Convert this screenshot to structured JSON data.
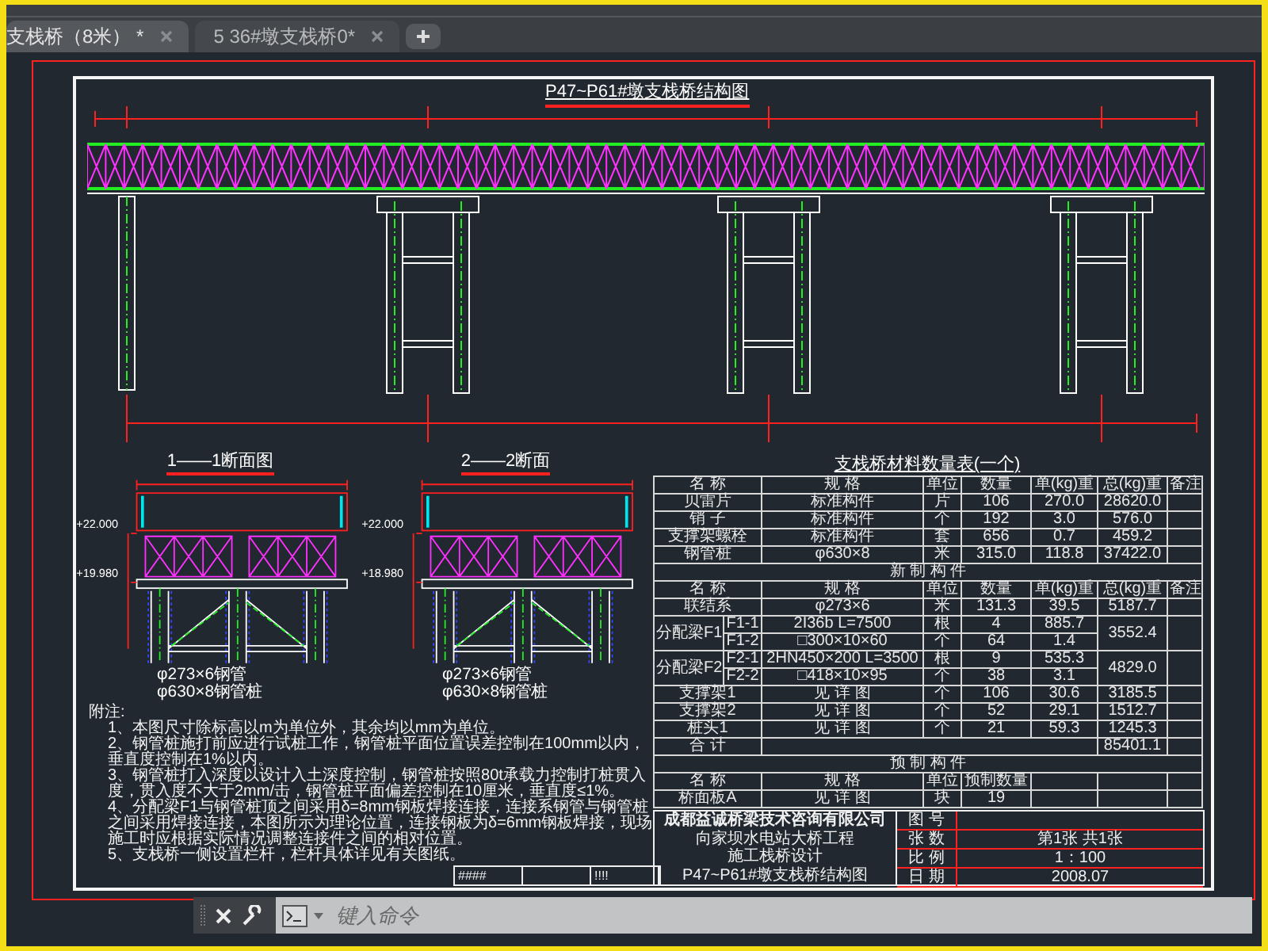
{
  "tabs": [
    {
      "label": "支栈桥（8米） *",
      "selected": true
    },
    {
      "label": "5 36#墩支栈桥0*",
      "selected": false
    }
  ],
  "drawing": {
    "title": "P47~P61#墩支栈桥结构图",
    "sections": [
      {
        "title": "1——1断面图",
        "deck_level": "+22.000",
        "cap_level": "+19.980",
        "brace_label": "φ273×6钢管",
        "pile_label": "φ630×8钢管桩"
      },
      {
        "title": "2——2断面",
        "deck_level": "+22.000",
        "cap_level": "+18.980",
        "brace_label": "φ273×6钢管",
        "pile_label": "φ630×8钢管桩"
      }
    ],
    "material_table": {
      "title": "支栈桥材料数量表(一个)",
      "rows": [
        {
          "kind": "header",
          "cells": [
            "名 称",
            "规 格",
            "单位",
            "数量",
            "单(kg)重",
            "总(kg)重",
            "备注"
          ]
        },
        {
          "kind": "item",
          "cells": [
            "贝雷片",
            "标准构件",
            "片",
            "106",
            "270.0",
            "28620.0"
          ]
        },
        {
          "kind": "item",
          "cells": [
            "销 子",
            "标准构件",
            "个",
            "192",
            "3.0",
            "576.0"
          ]
        },
        {
          "kind": "item",
          "cells": [
            "支撑架螺栓",
            "标准构件",
            "套",
            "656",
            "0.7",
            "459.2"
          ]
        },
        {
          "kind": "item",
          "cells": [
            "钢管桩",
            "φ630×8",
            "米",
            "315.0",
            "118.8",
            "37422.0"
          ]
        },
        {
          "kind": "section",
          "label": "新 制 构 件"
        },
        {
          "kind": "header",
          "cells": [
            "名 称",
            "规 格",
            "单位",
            "数量",
            "单(kg)重",
            "总(kg)重",
            "备注"
          ]
        },
        {
          "kind": "item",
          "cells": [
            "联结系",
            "φ273×6",
            "米",
            "131.3",
            "39.5",
            "5187.7"
          ]
        },
        {
          "kind": "group",
          "name": "分配梁F1",
          "total": "3552.4",
          "parts": [
            {
              "cells": [
                "F1-1",
                "2I36b L=7500",
                "根",
                "4",
                "885.7"
              ]
            },
            {
              "cells": [
                "F1-2",
                "□300×10×60",
                "个",
                "64",
                "1.4"
              ]
            }
          ]
        },
        {
          "kind": "group",
          "name": "分配梁F2",
          "total": "4829.0",
          "parts": [
            {
              "cells": [
                "F2-1",
                "2HN450×200 L=3500",
                "根",
                "9",
                "535.3"
              ]
            },
            {
              "cells": [
                "F2-2",
                "□418×10×95",
                "个",
                "38",
                "3.1"
              ]
            }
          ]
        },
        {
          "kind": "item",
          "cells": [
            "支撑架1",
            "见 详 图",
            "个",
            "106",
            "30.6",
            "3185.5"
          ]
        },
        {
          "kind": "item",
          "cells": [
            "支撑架2",
            "见 详 图",
            "个",
            "52",
            "29.1",
            "1512.7"
          ]
        },
        {
          "kind": "item",
          "cells": [
            "桩头1",
            "见 详 图",
            "个",
            "21",
            "59.3",
            "1245.3"
          ]
        },
        {
          "kind": "total",
          "label": "合 计",
          "value": "85401.1"
        },
        {
          "kind": "section",
          "label": "预 制 构 件"
        },
        {
          "kind": "header",
          "cells": [
            "名 称",
            "规 格",
            "单位",
            "预制数量"
          ]
        },
        {
          "kind": "item",
          "cells": [
            "桥面板A",
            "见 详 图",
            "块",
            "19"
          ]
        }
      ]
    },
    "notes": {
      "heading": "附注:",
      "items": [
        "1、本图尺寸除标高以m为单位外，其余均以mm为单位。",
        "2、钢管桩施打前应进行试桩工作，钢管桩平面位置误差控制在100mm以内，垂直度控制在1%以内。",
        "3、钢管桩打入深度以设计入土深度控制，钢管桩按照80t承载力控制打桩贯入度，贯入度不大于2mm/击，钢管桩平面偏差控制在10厘米，垂直度≤1%。",
        "4、分配梁F1与钢管桩顶之间采用δ=8mm钢板焊接连接，连接系钢管与钢管桩之间采用焊接连接，本图所示为理论位置，连接钢板为δ=6mm钢板焊接，现场施工时应根据实际情况调整连接件之间的相对位置。",
        "5、支栈桥一侧设置栏杆，栏杆具体详见有关图纸。"
      ]
    },
    "revision_cells": [
      "####",
      "!!!!"
    ],
    "title_block": {
      "company": "成都益诚桥梁技术咨询有限公司",
      "project": "向家坝水电站大桥工程",
      "design": "施工栈桥设计",
      "drawing_title": "P47~P61#墩支栈桥结构图",
      "fields": [
        {
          "label": "图 号"
        },
        {
          "label": "张 数",
          "value": "第1张 共1张"
        },
        {
          "label": "比 例",
          "value": "1：100"
        },
        {
          "label": "日 期",
          "value": "2008.07"
        }
      ]
    }
  },
  "command_line": {
    "placeholder": "键入命令"
  }
}
